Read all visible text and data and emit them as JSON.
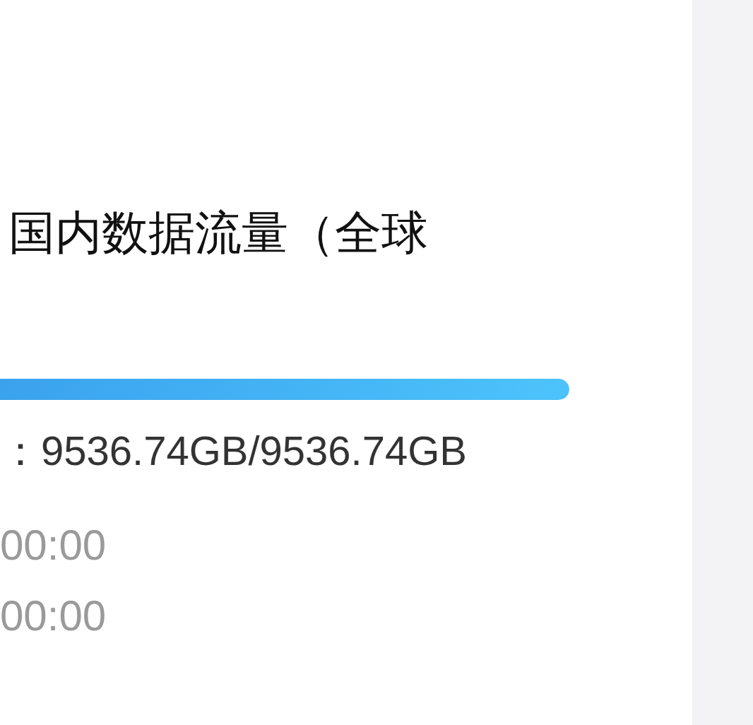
{
  "plan": {
    "title": "国内数据流量（全球",
    "usage": {
      "level": 1,
      "reading": "：9536.74GB/9536.74GB"
    },
    "times": [
      "00:00",
      "00:00"
    ]
  }
}
